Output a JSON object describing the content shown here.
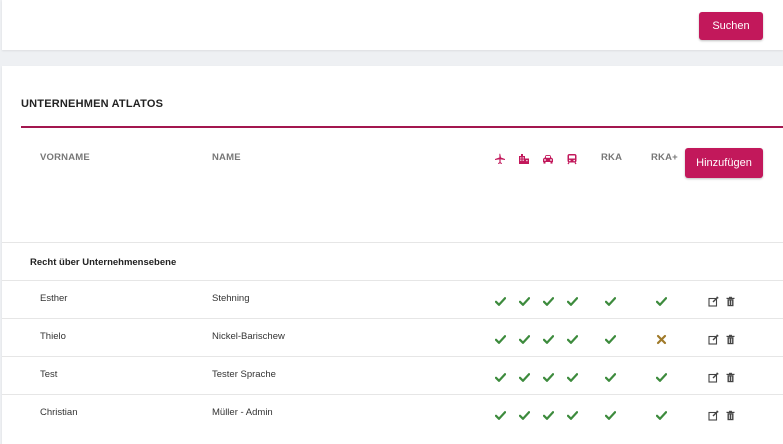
{
  "search": {
    "button_label": "Suchen"
  },
  "section": {
    "title": "UNTERNEHMEN ATLATOS",
    "add_button_label": "Hinzufügen"
  },
  "table": {
    "headers": {
      "first_name": "VORNAME",
      "last_name": "NAME",
      "icons": [
        "plane-icon",
        "hotel-icon",
        "car-icon",
        "train-icon"
      ],
      "rka": "RKA",
      "rka_plus": "RKA+"
    },
    "group_label": "Recht über Unternehmensebene",
    "rows": [
      {
        "first_name": "Esther",
        "last_name": "Stehning",
        "flight": true,
        "hotel": true,
        "car": true,
        "train": true,
        "rka": true,
        "rka_plus": true
      },
      {
        "first_name": "Thielo",
        "last_name": "Nickel-Barischew",
        "flight": true,
        "hotel": true,
        "car": true,
        "train": true,
        "rka": true,
        "rka_plus": false
      },
      {
        "first_name": "Test",
        "last_name": "Tester Sprache",
        "flight": true,
        "hotel": true,
        "car": true,
        "train": true,
        "rka": true,
        "rka_plus": true
      },
      {
        "first_name": "Christian",
        "last_name": "Müller - Admin",
        "flight": true,
        "hotel": true,
        "car": true,
        "train": true,
        "rka": true,
        "rka_plus": true
      }
    ]
  },
  "colors": {
    "accent": "#c2185b",
    "check": "#3d8b3d",
    "cross": "#a07a2a"
  }
}
